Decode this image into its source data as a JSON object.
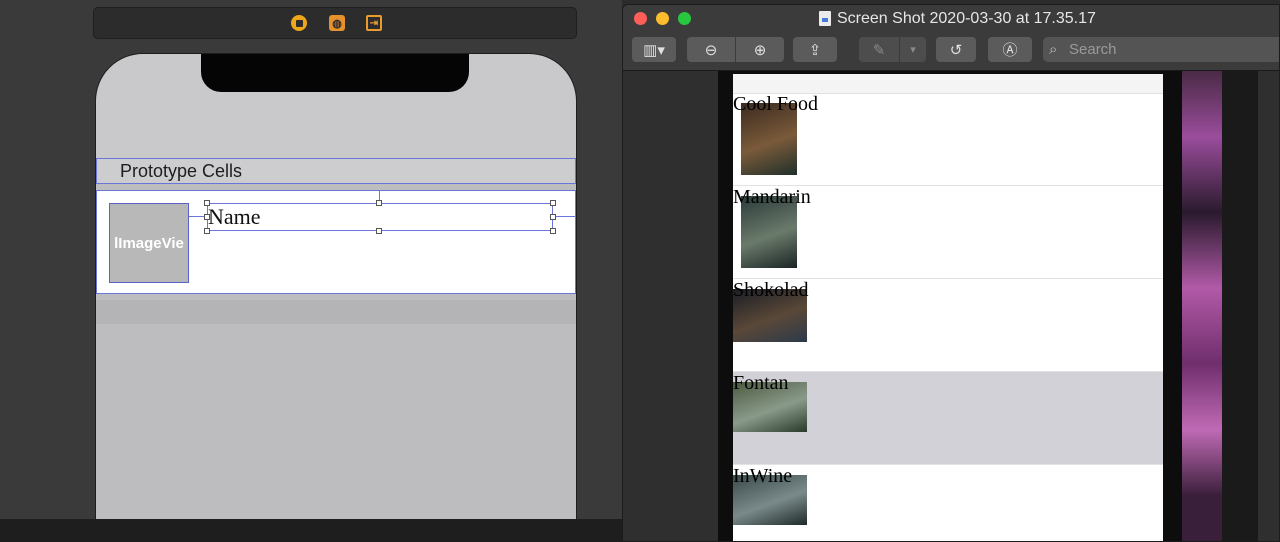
{
  "xcode": {
    "scene_icons": [
      "view-controller-icon",
      "first-responder-icon",
      "exit-icon"
    ],
    "exit_glyph": "⇥",
    "storyboard": {
      "section_header": "Prototype Cells",
      "image_placeholder": "lImageVie",
      "name_label": "Name"
    }
  },
  "preview": {
    "window_title": "Screen Shot 2020-03-30 at 17.35.17",
    "toolbar": {
      "sidebar_glyph": "▥▾",
      "zoom_out_glyph": "⊖",
      "zoom_in_glyph": "⊕",
      "share_glyph": "⇪",
      "markup_glyph": "✎",
      "markup_dropdown_glyph": "▾",
      "rotate_glyph": "↺",
      "annotate_glyph": "Ⓐ",
      "search_glyph": "⌕",
      "search_placeholder": "Search"
    },
    "restaurants": [
      {
        "name": "Cool Food",
        "thumb": [
          "#3b2a1f",
          "#7a5a3a",
          "#20302a"
        ],
        "selected": false
      },
      {
        "name": "Mandarin",
        "thumb": [
          "#2a3a3a",
          "#6a7a6a",
          "#1a2525"
        ],
        "selected": false
      },
      {
        "name": "Shokolad",
        "thumb": [
          "#1a1d24",
          "#5a4838",
          "#2c3a4a"
        ],
        "selected": false
      },
      {
        "name": "Fontan",
        "thumb": [
          "#4a5a40",
          "#8a9a8a",
          "#2a3a2a"
        ],
        "selected": true
      },
      {
        "name": "InWine",
        "thumb": [
          "#3a4a4a",
          "#7a8a8a",
          "#1f2a2a"
        ],
        "selected": false
      }
    ],
    "colors": {
      "close": "#fd5e57",
      "minimize": "#fdbc2e",
      "maximize": "#27c840",
      "selection": "#d2d1d7",
      "constraint": "#6b74d8"
    }
  }
}
